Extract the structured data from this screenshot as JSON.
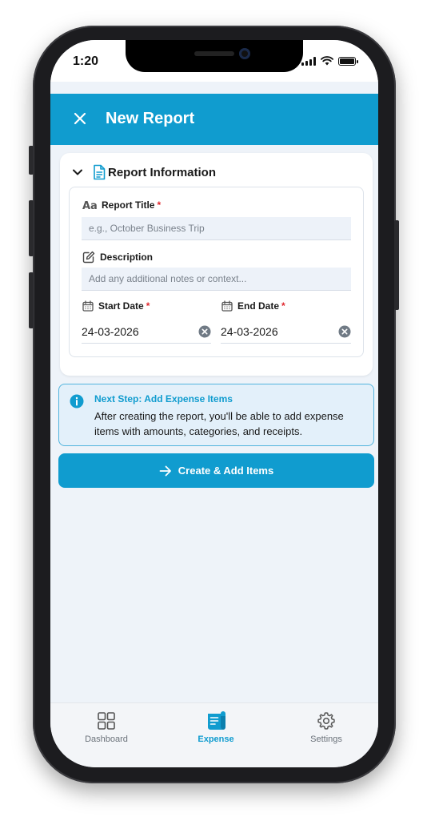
{
  "status_bar": {
    "time": "1:20"
  },
  "app_bar": {
    "title": "New Report"
  },
  "section": {
    "title": "Report Information",
    "report_title": {
      "label": "Report Title",
      "required_mark": "*",
      "placeholder": "e.g., October Business Trip",
      "value": ""
    },
    "description": {
      "label": "Description",
      "placeholder": "Add any additional notes or context...",
      "value": ""
    },
    "start_date": {
      "label": "Start Date",
      "required_mark": "*",
      "value": "24-03-2026"
    },
    "end_date": {
      "label": "End Date",
      "required_mark": "*",
      "value": "24-03-2026"
    }
  },
  "info": {
    "title": "Next Step: Add Expense Items",
    "text": "After creating the report, you'll be able to add expense items with amounts, categories, and receipts."
  },
  "cta": {
    "label": "Create & Add Items"
  },
  "tabs": [
    {
      "label": "Dashboard",
      "icon": "grid-icon"
    },
    {
      "label": "Expense",
      "icon": "receipt-icon",
      "active": true
    },
    {
      "label": "Settings",
      "icon": "gear-icon"
    }
  ],
  "colors": {
    "primary": "#109ccf",
    "required": "#e0282e",
    "background": "#eef3f9",
    "info_bg": "#e3f0fa"
  }
}
